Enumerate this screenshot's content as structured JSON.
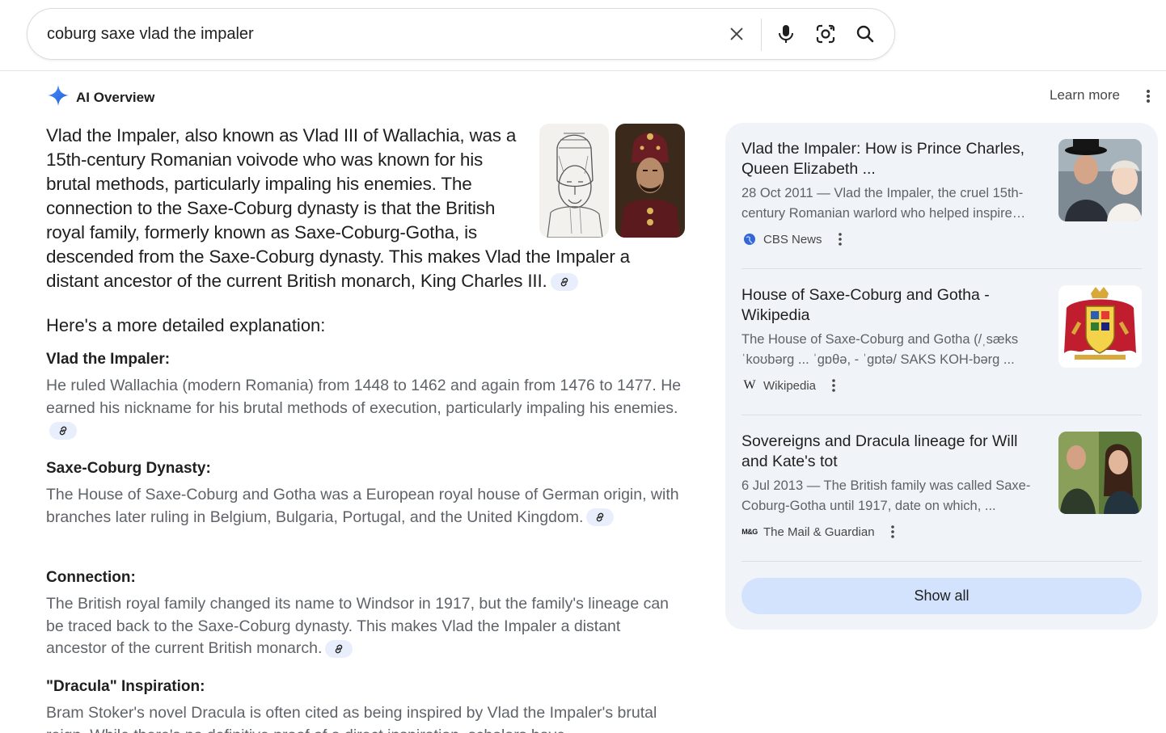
{
  "search": {
    "query": "coburg saxe vlad the impaler",
    "icons": [
      "close-icon",
      "microphone-icon",
      "lens-camera-icon",
      "search-icon"
    ]
  },
  "ai_overview": {
    "title": "AI Overview",
    "learn_more": "Learn more",
    "summary": "Vlad the Impaler, also known as Vlad III of Wallachia, was a 15th-century Romanian voivode who was known for his brutal methods, particularly impaling his enemies. The connection to the Saxe-Coburg dynasty is that the British royal family, formerly known as Saxe-Coburg-Gotha, is descended from the Saxe-Coburg dynasty. This makes Vlad the Impaler a distant ancestor of the current British monarch, King Charles III.",
    "detail_heading": "Here's a more detailed explanation:",
    "sections": [
      {
        "title": "Vlad the Impaler:",
        "body": "He ruled Wallachia (modern Romania) from 1448 to 1462 and again from 1476 to 1477. He earned his nickname for his brutal methods of execution, particularly impaling his enemies."
      },
      {
        "title": "Saxe-Coburg Dynasty:",
        "body": "The House of Saxe-Coburg and Gotha was a European royal house of German origin, with branches later ruling in Belgium, Bulgaria, Portugal, and the United Kingdom."
      },
      {
        "title": "Connection:",
        "body": "The British royal family changed its name to Windsor in 1917, but the family's lineage can be traced back to the Saxe-Coburg dynasty. This makes Vlad the Impaler a distant ancestor of the current British monarch."
      },
      {
        "title": "\"Dracula\" Inspiration:",
        "body": "Bram Stoker's novel Dracula is often cited as being inspired by Vlad the Impaler's brutal reign. While there's no definitive proof of a direct inspiration, scholars have"
      }
    ]
  },
  "sources": {
    "cards": [
      {
        "title": "Vlad the Impaler: How is Prince Charles, Queen Elizabeth ...",
        "snippet": "28 Oct 2011 — Vlad the Impaler, the cruel 15th-century Romanian warlord who helped inspire Bram Stoker's Dracula...",
        "source": "CBS News",
        "icon": "globe-icon"
      },
      {
        "title": "House of Saxe-Coburg and Gotha - Wikipedia",
        "snippet": "The House of Saxe-Coburg and Gotha (/ˌsæks ˈkoʊbərɡ ... ˈɡɒθə, - ˈɡɒtə/ SAKS KOH-bərg ...",
        "source": "Wikipedia",
        "icon": "wikipedia-icon",
        "icon_text": "W"
      },
      {
        "title": "Sovereigns and Dracula lineage for Will and Kate's tot",
        "snippet": "6 Jul 2013 — The British family was called Saxe-Coburg-Gotha until 1917, date on which, ...",
        "source": "The Mail & Guardian",
        "icon": "mail-guardian-icon",
        "icon_text": "M&G"
      }
    ],
    "show_all": "Show all"
  }
}
